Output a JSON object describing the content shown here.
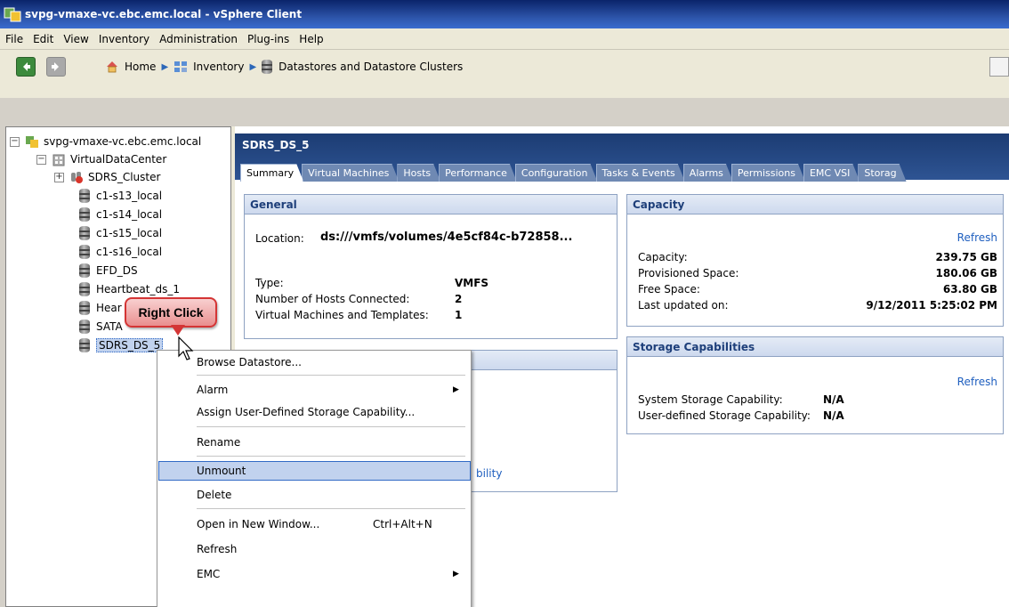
{
  "window": {
    "title": "svpg-vmaxe-vc.ebc.emc.local - vSphere Client"
  },
  "menu": [
    "File",
    "Edit",
    "View",
    "Inventory",
    "Administration",
    "Plug-ins",
    "Help"
  ],
  "breadcrumb": {
    "home": "Home",
    "inventory": "Inventory",
    "current": "Datastores and Datastore Clusters"
  },
  "tree": {
    "root": "svpg-vmaxe-vc.ebc.emc.local",
    "datacenter": "VirtualDataCenter",
    "cluster": "SDRS_Cluster",
    "datastores": [
      "c1-s13_local",
      "c1-s14_local",
      "c1-s15_local",
      "c1-s16_local",
      "EFD_DS",
      "Heartbeat_ds_1",
      "Hear",
      "SATA",
      "SDRS_DS_5"
    ],
    "expander_expanded": "−",
    "expander_collapsed": "+"
  },
  "header": {
    "title": "SDRS_DS_5"
  },
  "tabs": [
    "Summary",
    "Virtual Machines",
    "Hosts",
    "Performance",
    "Configuration",
    "Tasks & Events",
    "Alarms",
    "Permissions",
    "EMC VSI",
    "Storag"
  ],
  "general": {
    "title": "General",
    "location_label": "Location:",
    "location_value": "ds:///vmfs/volumes/4e5cf84c-b72858...",
    "type_label": "Type:",
    "type_value": "VMFS",
    "hosts_label": "Number of Hosts Connected:",
    "hosts_value": "2",
    "vms_label": "Virtual Machines and Templates:",
    "vms_value": "1"
  },
  "second_panel": {
    "link_fragment": "bility"
  },
  "capacity": {
    "title": "Capacity",
    "refresh": "Refresh",
    "capacity_label": "Capacity:",
    "capacity_value": "239.75 GB",
    "provisioned_label": "Provisioned Space:",
    "provisioned_value": "180.06 GB",
    "free_label": "Free Space:",
    "free_value": "63.80 GB",
    "updated_label": "Last updated on:",
    "updated_value": "9/12/2011 5:25:02 PM"
  },
  "storage_capabilities": {
    "title": "Storage Capabilities",
    "refresh": "Refresh",
    "system_label": "System Storage Capability:",
    "system_value": "N/A",
    "user_label": "User-defined Storage Capability:",
    "user_value": "N/A"
  },
  "callout": {
    "text": "Right Click"
  },
  "context_menu": {
    "browse": "Browse Datastore...",
    "alarm": "Alarm",
    "assign": "Assign User-Defined Storage Capability...",
    "rename": "Rename",
    "unmount": "Unmount",
    "delete": "Delete",
    "open_new": "Open in New Window...",
    "open_new_shortcut": "Ctrl+Alt+N",
    "refresh": "Refresh",
    "emc": "EMC",
    "submenu_arrow": "▶"
  },
  "colors": {
    "title_bar": "#0a246a",
    "object_header": "#1c3c73",
    "panel_title": "#1e3f7a",
    "link": "#1f5fbf",
    "callout_border": "#d43535"
  }
}
